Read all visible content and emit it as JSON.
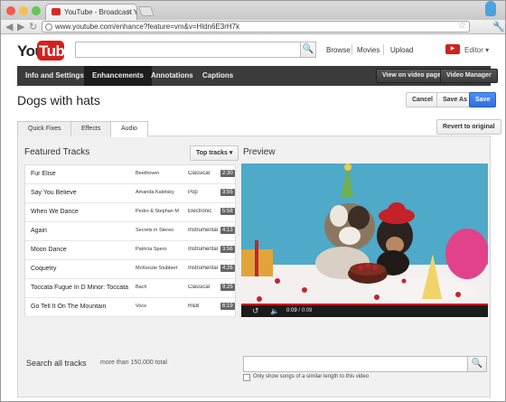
{
  "browser": {
    "tab_title": "YouTube - Broadcast Yourse",
    "url": "www.youtube.com/enhance?feature=vm&v=Hldn6E3rH7k"
  },
  "header": {
    "logo": {
      "you": "You",
      "tube": "Tube"
    },
    "links": [
      "Browse",
      "Movies",
      "Upload"
    ],
    "user_label": "Editor"
  },
  "nav": {
    "tabs": [
      "Info and Settings",
      "Enhancements",
      "Annotations",
      "Captions"
    ],
    "active_tab": "Enhancements",
    "view_button": "View on video page",
    "manager_button": "Video Manager"
  },
  "page": {
    "title": "Dogs with hats",
    "cancel": "Cancel",
    "save_as": "Save As",
    "save": "Save"
  },
  "subtabs": [
    "Quick Fixes",
    "Effects",
    "Audio"
  ],
  "active_subtab": "Audio",
  "revert": "Revert to original",
  "tracks": {
    "heading": "Featured Tracks",
    "sort_button": "Top tracks",
    "rows": [
      {
        "title": "Fur Elise",
        "artist": "Beethoven",
        "genre": "Classical",
        "duration": "2:30"
      },
      {
        "title": "Say You Believe",
        "artist": "Amanda Kaletsky",
        "genre": "Pop",
        "duration": "3:55"
      },
      {
        "title": "When We Dance",
        "artist": "Pedro & Stephan M",
        "genre": "Electronic",
        "duration": "5:58"
      },
      {
        "title": "Again",
        "artist": "Secrets in Stereo",
        "genre": "Instrumental",
        "duration": "4:13"
      },
      {
        "title": "Moon Dance",
        "artist": "Patricia Spero",
        "genre": "Instrumental",
        "duration": "3:56"
      },
      {
        "title": "Coquetry",
        "artist": "McKenzie Stubbert",
        "genre": "Instrumental",
        "duration": "4:26"
      },
      {
        "title": "Toccata Fugue In D Minor: Toccata",
        "artist": "Bach",
        "genre": "Classical",
        "duration": "9:25"
      },
      {
        "title": "Go Tell It On The Mountain",
        "artist": "Voce",
        "genre": "R&B",
        "duration": "6:19"
      }
    ]
  },
  "preview": {
    "heading": "Preview",
    "time_current": "0:09",
    "time_total": "/ 0:09",
    "progress": 1.0
  },
  "search_all": {
    "label": "Search all tracks",
    "count": "more than 150,000 total",
    "checkbox_label": "Only show songs of a similar length to this video"
  }
}
